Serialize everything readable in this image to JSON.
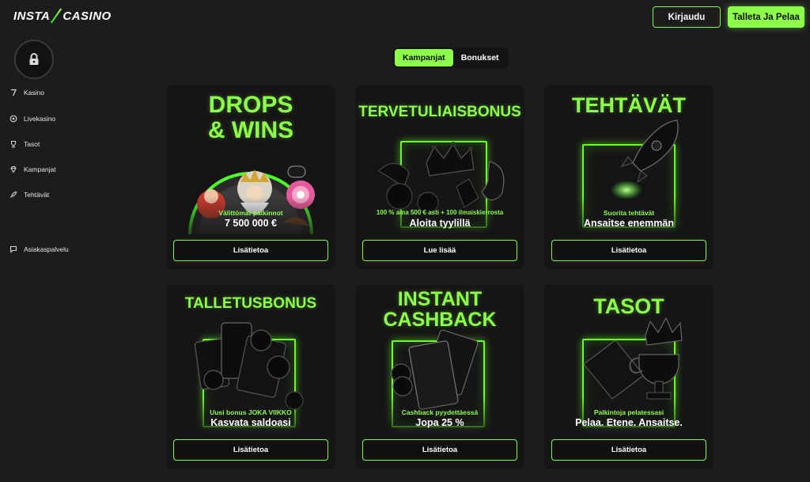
{
  "header": {
    "logo_left": "INSTA",
    "logo_right": "CASINO",
    "login_label": "Kirjaudu",
    "deposit_label": "Talleta Ja Pelaa"
  },
  "sidebar": {
    "items": [
      {
        "label": "Kasino",
        "icon": "seven-icon"
      },
      {
        "label": "Livekasino",
        "icon": "chip-icon"
      },
      {
        "label": "Tasot",
        "icon": "trophy-icon"
      },
      {
        "label": "Kampanjat",
        "icon": "diamond-icon"
      },
      {
        "label": "Tehtävät",
        "icon": "rocket-icon"
      },
      {
        "label": "Asiakaspalvelu",
        "icon": "chat-icon"
      }
    ]
  },
  "tabs": [
    {
      "label": "Kampanjat",
      "active": true
    },
    {
      "label": "Bonukset",
      "active": false
    }
  ],
  "cards": [
    {
      "title_line1": "DROPS",
      "title_line2": "& WINS",
      "sub": "Välittömät palkinnot",
      "head": "7 500 000 €",
      "cta": "Lisätietoa"
    },
    {
      "title_line1": "TERVETULIAISBONUS",
      "title_line2": "",
      "sub": "100 % aina 500 € asti + 100 ilmaiskierrosta",
      "head": "Aloita tyylillä",
      "cta": "Lue lisää"
    },
    {
      "title_line1": "TEHTÄVÄT",
      "title_line2": "",
      "sub": "Suorita tehtävät",
      "head": "Ansaitse enemmän",
      "cta": "Lisätietoa"
    },
    {
      "title_line1": "TALLETUSBONUS",
      "title_line2": "",
      "sub": "Uusi bonus JOKA VIIKKO",
      "head": "Kasvata saldoasi",
      "cta": "Lisätietoa"
    },
    {
      "title_line1": "INSTANT",
      "title_line2": "CASHBACK",
      "sub": "Cashback pyydettäessä",
      "head": "Jopa 25 %",
      "cta": "Lisätietoa"
    },
    {
      "title_line1": "TASOT",
      "title_line2": "",
      "sub": "Palkintoja pelatessasi",
      "head": "Pelaa. Etene. Ansaitse.",
      "cta": "Lisätietoa"
    }
  ],
  "colors": {
    "accent": "#8cff4a",
    "background": "#1c1c1c",
    "card": "#151515"
  }
}
